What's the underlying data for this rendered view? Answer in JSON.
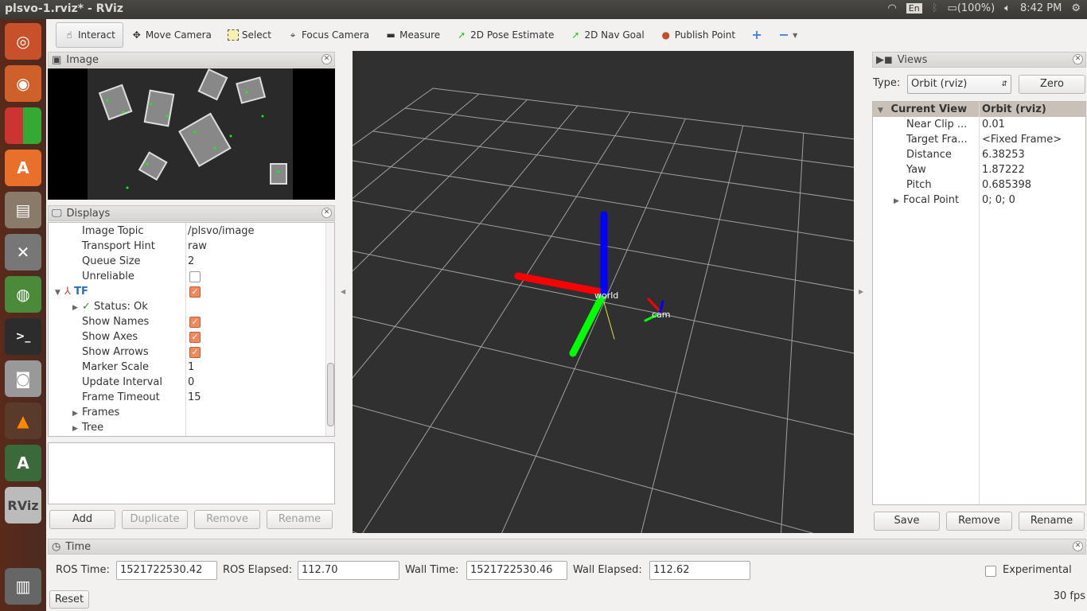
{
  "window": {
    "title": "plsvo-1.rviz* - RViz"
  },
  "tray": {
    "keyboard": "En",
    "battery": "(100%)",
    "time": "8:42 PM",
    "icons": [
      "wifi-icon",
      "bluetooth-icon",
      "battery-icon",
      "volume-icon",
      "power-gear-icon"
    ]
  },
  "launcher": {
    "items": [
      "ubuntu-dash",
      "firefox",
      "libreoffice",
      "software-center",
      "files",
      "system-settings",
      "update-manager",
      "terminal",
      "camera",
      "vlc",
      "software-updater",
      "rviz",
      "trash"
    ]
  },
  "toolbar": {
    "tools": [
      {
        "label": "Interact",
        "icon": "hand-icon",
        "active": true
      },
      {
        "label": "Move Camera",
        "icon": "move-icon"
      },
      {
        "label": "Select",
        "icon": "select-box-icon"
      },
      {
        "label": "Focus Camera",
        "icon": "crosshair-icon"
      },
      {
        "label": "Measure",
        "icon": "ruler-icon"
      },
      {
        "label": "2D Pose Estimate",
        "icon": "green-arrow-icon"
      },
      {
        "label": "2D Nav Goal",
        "icon": "green-arrow-icon"
      },
      {
        "label": "Publish Point",
        "icon": "map-pin-icon"
      }
    ]
  },
  "image_panel": {
    "title": "Image"
  },
  "displays": {
    "title": "Displays",
    "rows": [
      {
        "name": "Image Topic",
        "value": "/plsvo/image"
      },
      {
        "name": "Transport Hint",
        "value": "raw"
      },
      {
        "name": "Queue Size",
        "value": "2"
      },
      {
        "name": "Unreliable",
        "checkbox": false
      },
      {
        "name": "TF",
        "checkbox": true,
        "expanded": true
      },
      {
        "name": "Status: Ok"
      },
      {
        "name": "Show Names",
        "checkbox": true
      },
      {
        "name": "Show Axes",
        "checkbox": true
      },
      {
        "name": "Show Arrows",
        "checkbox": true
      },
      {
        "name": "Marker Scale",
        "value": "1"
      },
      {
        "name": "Update Interval",
        "value": "0"
      },
      {
        "name": "Frame Timeout",
        "value": "15"
      },
      {
        "name": "Frames"
      },
      {
        "name": "Tree"
      }
    ],
    "buttons": {
      "add": "Add",
      "duplicate": "Duplicate",
      "remove": "Remove",
      "rename": "Rename"
    }
  },
  "viewport": {
    "frames": {
      "world": "world",
      "cam": "cam"
    },
    "colors": {
      "background": "#303030",
      "x": "#ff0000",
      "y": "#00ff00",
      "z": "#0000ff"
    }
  },
  "views": {
    "title": "Views",
    "type_label": "Type:",
    "type_value": "Orbit (rviz)",
    "zero": "Zero",
    "header": {
      "name": "Current View",
      "value": "Orbit (rviz)"
    },
    "rows": [
      {
        "name": "Near Clip ...",
        "value": "0.01"
      },
      {
        "name": "Target Fra...",
        "value": "<Fixed Frame>"
      },
      {
        "name": "Distance",
        "value": "6.38253"
      },
      {
        "name": "Yaw",
        "value": "1.87222"
      },
      {
        "name": "Pitch",
        "value": "0.685398"
      },
      {
        "name": "Focal Point",
        "value": "0; 0; 0"
      }
    ],
    "buttons": {
      "save": "Save",
      "remove": "Remove",
      "rename": "Rename"
    }
  },
  "time": {
    "title": "Time",
    "ros_time_label": "ROS Time:",
    "ros_time": "1521722530.42",
    "ros_elapsed_label": "ROS Elapsed:",
    "ros_elapsed": "112.70",
    "wall_time_label": "Wall Time:",
    "wall_time": "1521722530.46",
    "wall_elapsed_label": "Wall Elapsed:",
    "wall_elapsed": "112.62",
    "experimental": "Experimental",
    "reset": "Reset",
    "fps": "30 fps"
  }
}
